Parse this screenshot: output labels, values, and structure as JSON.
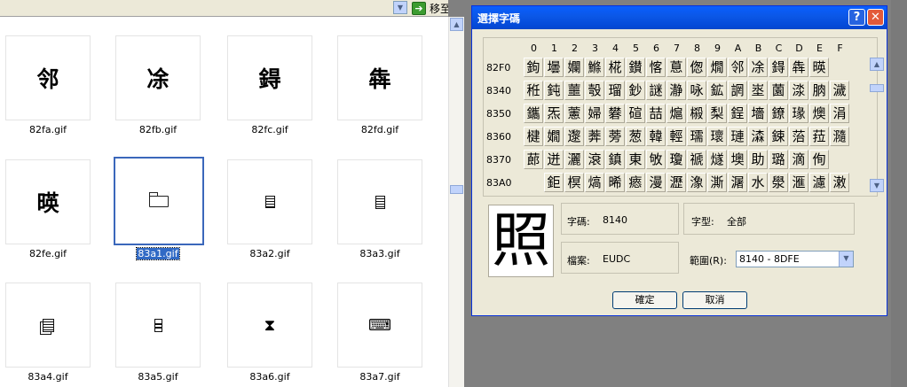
{
  "explorer": {
    "go_label": "移至",
    "tiles": [
      {
        "glyph": "邻",
        "caption": "82fa.gif"
      },
      {
        "glyph": "凃",
        "caption": "82fb.gif"
      },
      {
        "glyph": "鍀",
        "caption": "82fc.gif"
      },
      {
        "glyph": "犇",
        "caption": "82fd.gif"
      },
      {
        "glyph": "暎",
        "caption": "82fe.gif"
      },
      {
        "icon": "folder-open-icon",
        "caption": "83a1.gif",
        "selected": true
      },
      {
        "icon": "document-icon",
        "caption": "83a2.gif"
      },
      {
        "icon": "list-document-icon",
        "caption": "83a3.gif"
      },
      {
        "icon": "documents-icon",
        "caption": "83a4.gif"
      },
      {
        "icon": "phone-icon",
        "caption": "83a5.gif"
      },
      {
        "icon": "hourglass-icon",
        "caption": "83a6.gif"
      },
      {
        "icon": "keyboard-icon",
        "caption": "83a7.gif"
      }
    ]
  },
  "dialog": {
    "title": "選擇字碼",
    "help_label": "?",
    "close_label": "✕",
    "columns": [
      "0",
      "1",
      "2",
      "3",
      "4",
      "5",
      "6",
      "7",
      "8",
      "9",
      "A",
      "B",
      "C",
      "D",
      "E",
      "F"
    ],
    "rows": [
      {
        "code": "82F0",
        "chars": [
          "鉤",
          "壜",
          "孄",
          "鰷",
          "椛",
          "鑚",
          "愘",
          "蒠",
          "偬",
          "燗",
          "邻",
          "凃",
          "鍀",
          "犇",
          "暎",
          ""
        ]
      },
      {
        "code": "8340",
        "chars": [
          "秹",
          "鈍",
          "蘁",
          "彀",
          "瑠",
          "鈔",
          "謎",
          "瀞",
          "咏",
          "鉱",
          "誷",
          "埊",
          "薗",
          "渁",
          "朒",
          "濊"
        ]
      },
      {
        "code": "8350",
        "chars": [
          "鑴",
          "炁",
          "藼",
          "婦",
          "礬",
          "碹",
          "喆",
          "熩",
          "榝",
          "梨",
          "鋥",
          "墻",
          "鐐",
          "瑑",
          "燠",
          "涓"
        ]
      },
      {
        "code": "8360",
        "chars": [
          "楗",
          "嫺",
          "邌",
          "莾",
          "蒡",
          "葱",
          "韓",
          "輕",
          "瓀",
          "瓌",
          "璉",
          "潹",
          "鋉",
          "菭",
          "菈",
          "瀡"
        ]
      },
      {
        "code": "8370",
        "chars": [
          "蓈",
          "迸",
          "灑",
          "滖",
          "鎮",
          "東",
          "敂",
          "瓊",
          "禠",
          "燧",
          "墺",
          "助",
          "璐",
          "滴",
          "侚",
          ""
        ]
      },
      {
        "code": "83A0",
        "chars": [
          "",
          "鉅",
          "榠",
          "熇",
          "晞",
          "瘱",
          "漫",
          "瀝",
          "潒",
          "澌",
          "潳",
          "水",
          "澩",
          "滙",
          "濾",
          "潄"
        ]
      }
    ],
    "preview_char": "照",
    "code_label": "字碼:",
    "code_value": "8140",
    "font_label": "字型:",
    "font_value": "全部",
    "file_label": "檔案:",
    "file_value": "EUDC",
    "range_label": "範圍(R):",
    "range_value": "8140 - 8DFE",
    "ok_label": "確定",
    "cancel_label": "取消"
  }
}
